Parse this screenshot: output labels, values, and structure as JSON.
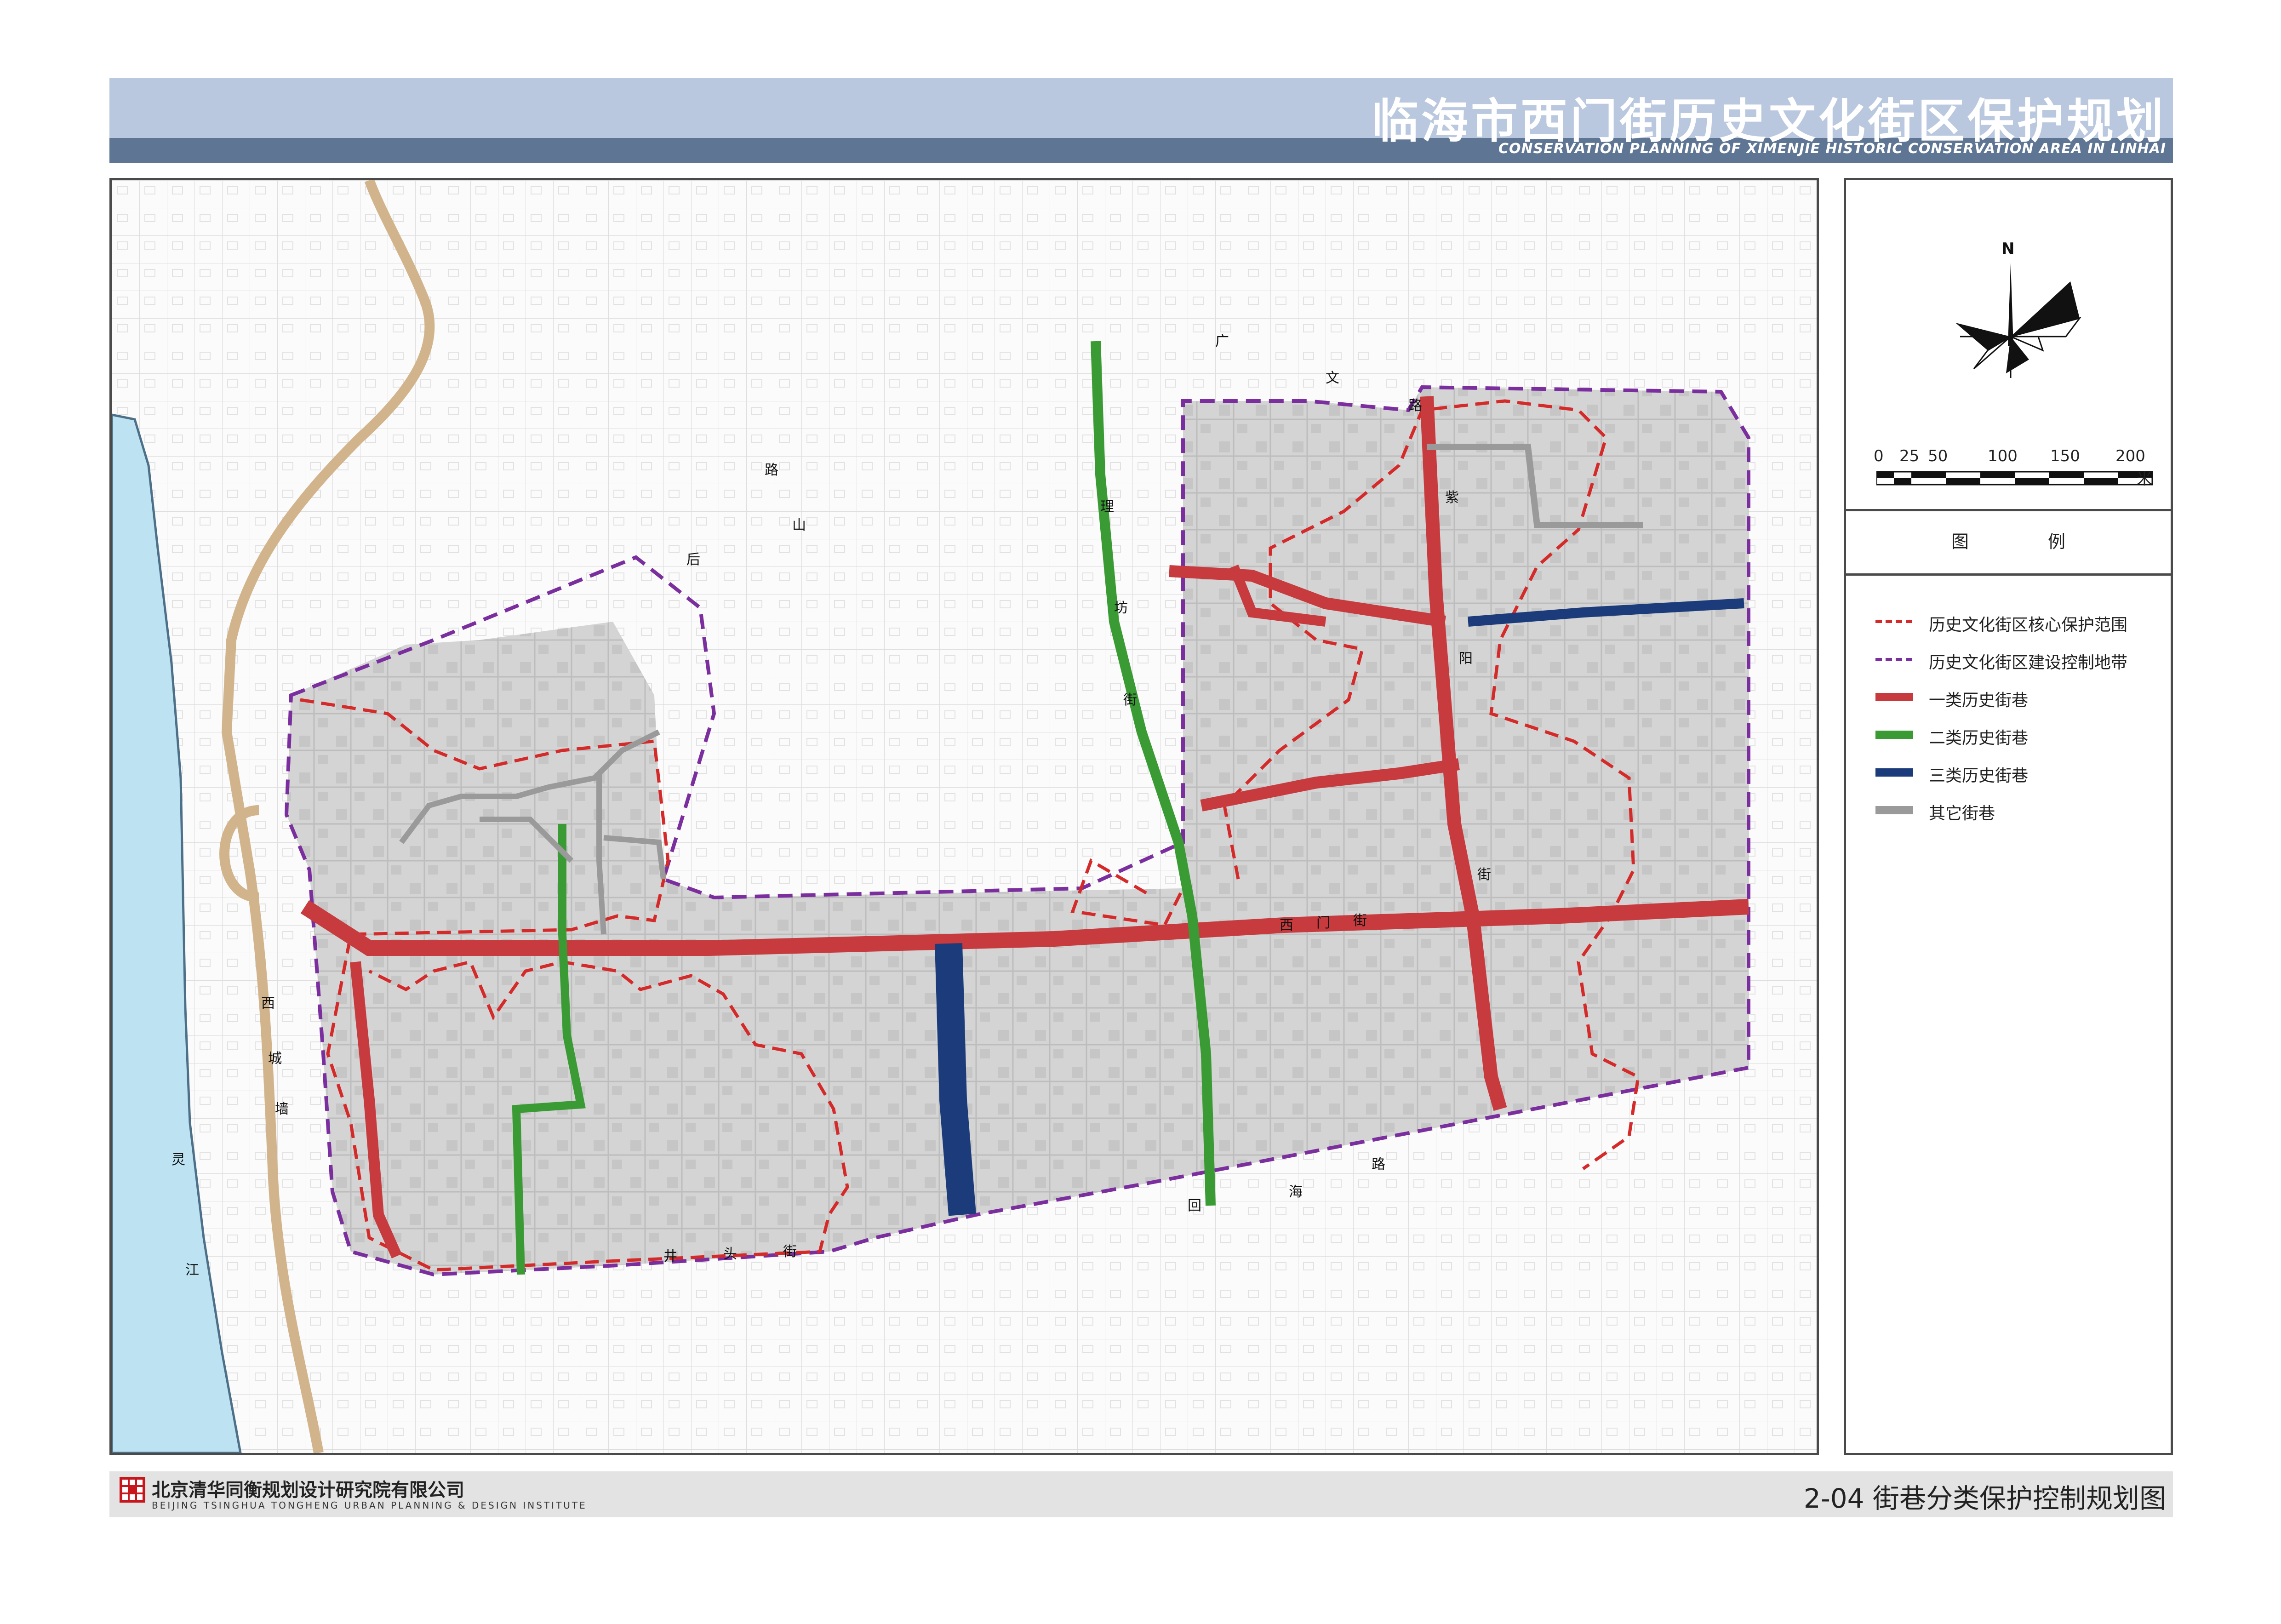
{
  "header": {
    "title_cn": "临海市西门街历史文化街区保护规划",
    "title_en": "CONSERVATION PLANNING OF XIMENJIE HISTORIC CONSERVATION AREA IN LINHAI"
  },
  "compass": {
    "north_label": "N"
  },
  "scale_bar": {
    "ticks": [
      "0",
      "25",
      "50",
      "100",
      "150",
      "200"
    ],
    "unit": "米"
  },
  "legend": {
    "title": "图 例",
    "items": [
      {
        "label": "历史文化街区核心保护范围",
        "style": "dashed",
        "color": "#d42a2a"
      },
      {
        "label": "历史文化街区建设控制地带",
        "style": "dashed",
        "color": "#7b2f9e"
      },
      {
        "label": "一类历史街巷",
        "style": "solid",
        "color": "#c73a3e"
      },
      {
        "label": "二类历史街巷",
        "style": "solid",
        "color": "#3a9b35"
      },
      {
        "label": "三类历史街巷",
        "style": "solid",
        "color": "#1b3b7a"
      },
      {
        "label": "其它街巷",
        "style": "solid",
        "color": "#9a9a9a"
      }
    ]
  },
  "map": {
    "river_color": "#bde3f2",
    "city_wall_color": "#d2b48c",
    "block_color": "#d4d4d4",
    "street_labels": {
      "guangwen_road": [
        "广",
        "文",
        "路"
      ],
      "houshan_road": [
        "后",
        "山",
        "路"
      ],
      "huihai_road": [
        "回",
        "海",
        "路"
      ],
      "ximen_street": [
        "西",
        "门",
        "街"
      ],
      "ziyang_street": [
        "紫",
        "阳",
        "街"
      ],
      "lixin_street": [
        "理",
        "坊",
        "街"
      ],
      "xicheng_wall": [
        "西",
        "城",
        "墙"
      ],
      "lingjiang": [
        "灵",
        "江"
      ],
      "jingtou_street": [
        "井",
        "头",
        "街"
      ]
    }
  },
  "footer": {
    "institute_cn": "北京清华同衡规划设计研究院有限公司",
    "institute_en": "BEIJING TSINGHUA TONGHENG URBAN PLANNING & DESIGN INSTITUTE",
    "plate_title": "2-04 街巷分类保护控制规划图"
  }
}
